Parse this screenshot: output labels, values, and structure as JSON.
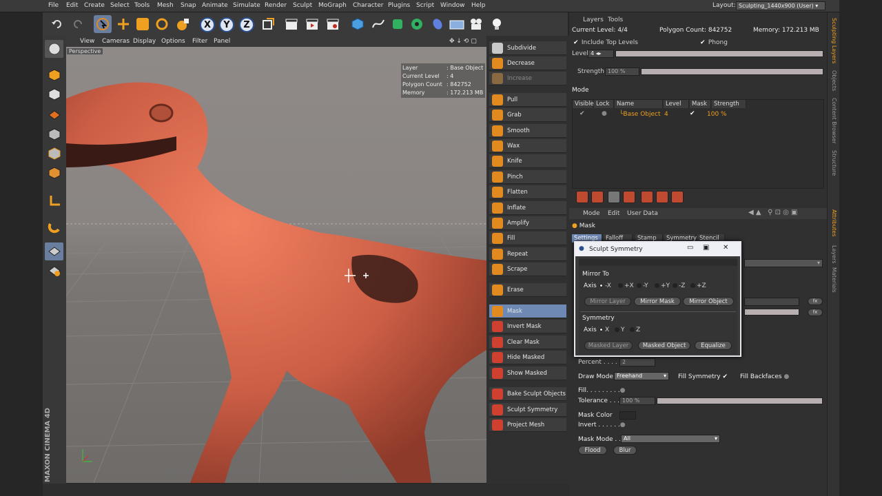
{
  "menubar": {
    "items": [
      "File",
      "Edit",
      "Create",
      "Select",
      "Tools",
      "Mesh",
      "Snap",
      "Animate",
      "Simulate",
      "Render",
      "Sculpt",
      "MoGraph",
      "Character",
      "Plugins",
      "Script",
      "Window",
      "Help"
    ],
    "layout_label": "Layout:",
    "layout_value": "Sculpting_1440x900 (User)"
  },
  "toolbar": {
    "axis_x": "X",
    "axis_y": "Y",
    "axis_z": "Z"
  },
  "viewport": {
    "menu": [
      "View",
      "Cameras",
      "Display",
      "Options",
      "Filter",
      "Panel"
    ],
    "camera_label": "Perspective",
    "hud": {
      "rows": [
        {
          "key": "Layer",
          "value": ": Base Object"
        },
        {
          "key": "Current Level",
          "value": ": 4"
        },
        {
          "key": "Polygon Count",
          "value": ": 842752"
        },
        {
          "key": "Memory",
          "value": ": 172.213 MB"
        }
      ]
    },
    "brand": "MAXON CINEMA 4D"
  },
  "commands": {
    "items": [
      {
        "label": "Subdivide",
        "state": "normal",
        "color": "#c9c9c9"
      },
      {
        "label": "Decrease",
        "state": "normal",
        "color": "#e08a20"
      },
      {
        "label": "Increase",
        "state": "disabled",
        "color": "#8a6a40"
      },
      {
        "label": "Pull",
        "state": "normal",
        "color": "#e08a20"
      },
      {
        "label": "Grab",
        "state": "normal",
        "color": "#e08a20"
      },
      {
        "label": "Smooth",
        "state": "normal",
        "color": "#e08a20"
      },
      {
        "label": "Wax",
        "state": "normal",
        "color": "#e08a20"
      },
      {
        "label": "Knife",
        "state": "normal",
        "color": "#e08a20"
      },
      {
        "label": "Pinch",
        "state": "normal",
        "color": "#e08a20"
      },
      {
        "label": "Flatten",
        "state": "normal",
        "color": "#e08a20"
      },
      {
        "label": "Inflate",
        "state": "normal",
        "color": "#e08a20"
      },
      {
        "label": "Amplify",
        "state": "normal",
        "color": "#e08a20"
      },
      {
        "label": "Fill",
        "state": "normal",
        "color": "#e08a20"
      },
      {
        "label": "Repeat",
        "state": "normal",
        "color": "#e08a20"
      },
      {
        "label": "Scrape",
        "state": "normal",
        "color": "#e08a20"
      },
      {
        "label": "Erase",
        "state": "normal",
        "color": "#e08a20"
      },
      {
        "label": "Mask",
        "state": "selected",
        "color": "#e08a20"
      },
      {
        "label": "Invert Mask",
        "state": "normal",
        "color": "#d04030"
      },
      {
        "label": "Clear Mask",
        "state": "normal",
        "color": "#d04030"
      },
      {
        "label": "Hide Masked",
        "state": "normal",
        "color": "#d04030"
      },
      {
        "label": "Show Masked",
        "state": "normal",
        "color": "#d04030"
      },
      {
        "label": "Bake Sculpt Objects",
        "state": "normal",
        "color": "#d04030"
      },
      {
        "label": "Sculpt Symmetry",
        "state": "normal",
        "color": "#d04030"
      },
      {
        "label": "Project Mesh",
        "state": "normal",
        "color": "#d04030"
      }
    ]
  },
  "layers": {
    "menu": [
      "Layers",
      "Tools"
    ],
    "current_level": "Current Level: 4/4",
    "polygon_count": "Polygon Count: 842752",
    "memory": "Memory: 172.213 MB",
    "include_top_levels": "Include Top Levels",
    "phong": "Phong",
    "level_label": "Level",
    "level_value": "4",
    "strength_label": "Strength",
    "strength_value": "100 %",
    "mode_label": "Mode",
    "columns": [
      "Visible",
      "Lock",
      "Name",
      "Level",
      "Mask",
      "Strength"
    ],
    "rows": [
      {
        "name": "Base Object",
        "level": "4",
        "strength": "100 %"
      }
    ]
  },
  "attributes": {
    "menu": [
      "Mode",
      "Edit",
      "User Data"
    ],
    "title": "Mask",
    "tabs": [
      "Settings",
      "Falloff",
      "Stamp",
      "Symmetry",
      "Stencil"
    ],
    "percent_label": "Percent . . . . .",
    "percent_value": "2",
    "draw_mode_label": "Draw Mode",
    "draw_mode_value": "Freehand",
    "fill_symmetry": "Fill Symmetry",
    "fill_backfaces": "Fill Backfaces",
    "fill_label": "Fill. . . . . . . . .",
    "tolerance_label": "Tolerance . . . .",
    "tolerance_value": "100 %",
    "mask_color_label": "Mask Color",
    "invert_label": "Invert . . . . . .",
    "mask_mode_label": "Mask Mode . .",
    "mask_mode_value": "All",
    "flood": "Flood",
    "blur": "Blur",
    "fx": "fx"
  },
  "side_tabs": [
    "Sculpting Layers",
    "Objects",
    "Content Browser",
    "Structure",
    "Attributes",
    "Layers",
    "Materials"
  ],
  "dialog": {
    "title": "Sculpt Symmetry",
    "mirror_to": "Mirror To",
    "axis_label": "Axis",
    "mirror_axes": [
      "-X",
      "+X",
      "-Y",
      "+Y",
      "-Z",
      "+Z"
    ],
    "mirror_layer": "Mirror Layer",
    "mirror_mask": "Mirror Mask",
    "mirror_object": "Mirror Object",
    "symmetry": "Symmetry",
    "sym_axes": [
      "X",
      "Y",
      "Z"
    ],
    "masked_layer": "Masked Layer",
    "masked_object": "Masked Object",
    "equalize": "Equalize"
  }
}
